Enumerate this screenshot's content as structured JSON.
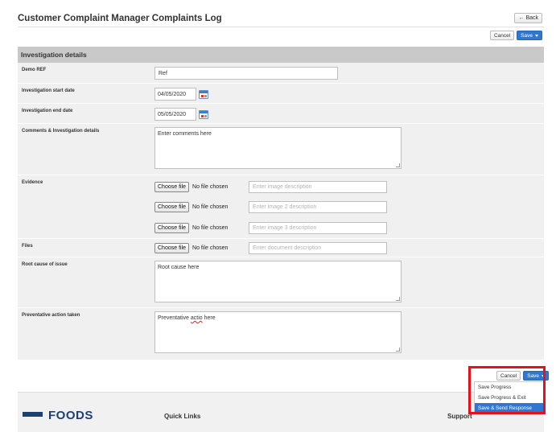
{
  "header": {
    "title": "Customer Complaint Manager Complaints Log",
    "back_label": "Back"
  },
  "toolbar": {
    "cancel_label": "Cancel",
    "save_label": "Save"
  },
  "section": {
    "title": "Investigation details"
  },
  "fields": {
    "demo_ref": {
      "label": "Demo REF",
      "value": "Ref"
    },
    "start_date": {
      "label": "Investigation start date",
      "value": "04/05/2020"
    },
    "end_date": {
      "label": "Investigation end date",
      "value": "05/05/2020"
    },
    "comments": {
      "label": "Comments & Investigation details",
      "value": "Enter comments here"
    },
    "evidence": {
      "label": "Evidence",
      "items": [
        {
          "button": "Choose file",
          "status": "No file chosen",
          "placeholder": "Enter image description"
        },
        {
          "button": "Choose file",
          "status": "No file chosen",
          "placeholder": "Enter image 2 description"
        },
        {
          "button": "Choose file",
          "status": "No file chosen",
          "placeholder": "Enter image 3 description"
        }
      ]
    },
    "files": {
      "label": "Files",
      "button": "Choose file",
      "status": "No file chosen",
      "placeholder": "Enter document description"
    },
    "root_cause": {
      "label": "Root cause of issue",
      "value": "Root cause here"
    },
    "preventative": {
      "label": "Preventative action taken",
      "value_prefix": "Preventative ",
      "value_misspelled": "actio",
      "value_suffix": " here"
    }
  },
  "bottom_actions": {
    "cancel_label": "Cancel",
    "save_label": "Save",
    "menu": [
      "Save Progress",
      "Save Progress & Exit",
      "Save & Send Response"
    ],
    "active_index": 2
  },
  "footer": {
    "logo_text": "FOODS",
    "quick_links": "Quick Links",
    "support": "Support"
  },
  "colors": {
    "accent": "#2f78d2",
    "highlight": "#e8101a",
    "section_header": "#c9c9c9",
    "row_bg": "#f0f0f0"
  }
}
